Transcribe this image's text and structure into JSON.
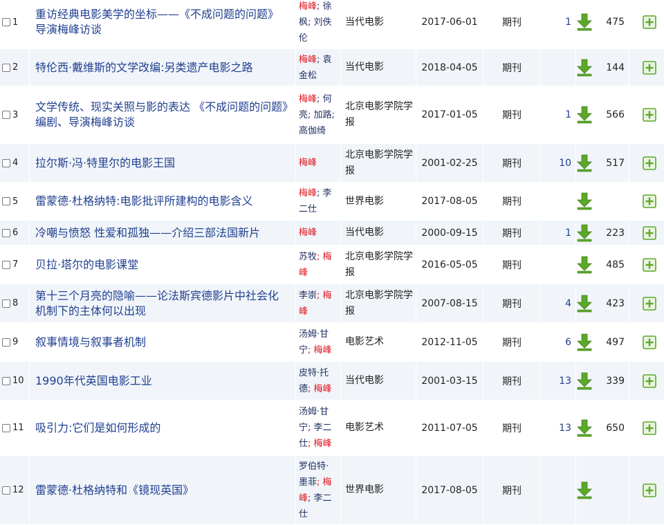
{
  "rows": [
    {
      "no": "1",
      "title": "重访经典电影美学的坐标——《不成问题的问题》导演梅峰访谈",
      "authors": [
        {
          "text": "梅峰",
          "hl": true
        },
        {
          "text": "; 徐枫",
          "hl": false
        },
        {
          "text": "; 刘佚伦",
          "hl": false
        }
      ],
      "source": "当代电影",
      "date": "2017-06-01",
      "type": "期刊",
      "cited": "1",
      "downloads": "475",
      "h": 77
    },
    {
      "no": "2",
      "title": "特伦西·戴维斯的文学改编:另类遗产电影之路",
      "authors": [
        {
          "text": "梅峰",
          "hl": true
        },
        {
          "text": "; 袁金松",
          "hl": false
        }
      ],
      "source": "当代电影",
      "date": "2018-04-05",
      "type": "期刊",
      "cited": "",
      "downloads": "144",
      "h": 54
    },
    {
      "no": "3",
      "title": "文学传统、现实关照与影的表达 《不成问题的问题》编剧、导演梅峰访谈",
      "authors": [
        {
          "text": "梅峰",
          "hl": true
        },
        {
          "text": "; 何亮",
          "hl": false
        },
        {
          "text": "; 加路",
          "hl": false
        },
        {
          "text": "; 高伽绮",
          "hl": false
        }
      ],
      "source": "北京电影学院学报",
      "date": "2017-01-05",
      "type": "期刊",
      "cited": "1",
      "downloads": "566",
      "h": 83
    },
    {
      "no": "4",
      "title": "拉尔斯·冯·特里尔的电影王国",
      "authors": [
        {
          "text": "梅峰",
          "hl": true
        }
      ],
      "source": "北京电影学院学报",
      "date": "2001-02-25",
      "type": "期刊",
      "cited": "10",
      "downloads": "517",
      "h": 56
    },
    {
      "no": "5",
      "title": "雷蒙德·杜格纳特:电影批评所建构的电影含义",
      "authors": [
        {
          "text": "梅峰",
          "hl": true
        },
        {
          "text": "; 李二仕",
          "hl": false
        }
      ],
      "source": "世界电影",
      "date": "2017-08-05",
      "type": "期刊",
      "cited": "",
      "downloads": "",
      "h": 55
    },
    {
      "no": "6",
      "title": "冷嘲与愤怒 性爱和孤独——介绍三部法国新片",
      "authors": [
        {
          "text": "梅峰",
          "hl": true
        }
      ],
      "source": "当代电影",
      "date": "2000-09-15",
      "type": "期刊",
      "cited": "1",
      "downloads": "223",
      "h": 36
    },
    {
      "no": "7",
      "title": "贝拉·塔尔的电影课堂",
      "authors": [
        {
          "text": "苏牧",
          "hl": false
        },
        {
          "text": "; 梅峰",
          "hl": true
        }
      ],
      "source": "北京电影学院学报",
      "date": "2016-05-05",
      "type": "期刊",
      "cited": "",
      "downloads": "485",
      "h": 56
    },
    {
      "no": "8",
      "title": "第十三个月亮的隐喻——论法斯宾德影片中社会化机制下的主体何以出现",
      "authors": [
        {
          "text": "李崇",
          "hl": false
        },
        {
          "text": "; 梅峰",
          "hl": true
        }
      ],
      "source": "北京电影学院学报",
      "date": "2007-08-15",
      "type": "期刊",
      "cited": "4",
      "downloads": "423",
      "h": 56
    },
    {
      "no": "9",
      "title": "叙事情境与叙事者机制",
      "authors": [
        {
          "text": "汤姆·甘宁",
          "hl": false
        },
        {
          "text": "; 梅峰",
          "hl": true
        }
      ],
      "source": "电影艺术",
      "date": "2012-11-05",
      "type": "期刊",
      "cited": "6",
      "downloads": "497",
      "h": 56
    },
    {
      "no": "10",
      "title": "1990年代英国电影工业",
      "authors": [
        {
          "text": "皮特·托德",
          "hl": false
        },
        {
          "text": "; 梅峰",
          "hl": true
        }
      ],
      "source": "当代电影",
      "date": "2001-03-15",
      "type": "期刊",
      "cited": "13",
      "downloads": "339",
      "h": 56
    },
    {
      "no": "11",
      "title": "吸引力:它们是如何形成的",
      "authors": [
        {
          "text": "汤姆·甘宁",
          "hl": false
        },
        {
          "text": "; 李二仕",
          "hl": false
        },
        {
          "text": "; 梅峰",
          "hl": true
        }
      ],
      "source": "电影艺术",
      "date": "2011-07-05",
      "type": "期刊",
      "cited": "13",
      "downloads": "650",
      "h": 80
    },
    {
      "no": "12",
      "title": "雷蒙德·杜格纳特和《镜现英国》",
      "authors": [
        {
          "text": "罗伯特·墨菲",
          "hl": false
        },
        {
          "text": "; 梅峰",
          "hl": true
        },
        {
          "text": "; 李二仕",
          "hl": false
        }
      ],
      "source": "世界电影",
      "date": "2017-08-05",
      "type": "期刊",
      "cited": "",
      "downloads": "",
      "h": 100
    }
  ],
  "icons": {
    "download": "download-arrow-icon",
    "add": "add-plus-icon"
  },
  "colors": {
    "link": "#1f3f8f",
    "highlight": "#e0141e",
    "row_alt": "#f1f5fa",
    "icon_green": "#5ca829"
  }
}
